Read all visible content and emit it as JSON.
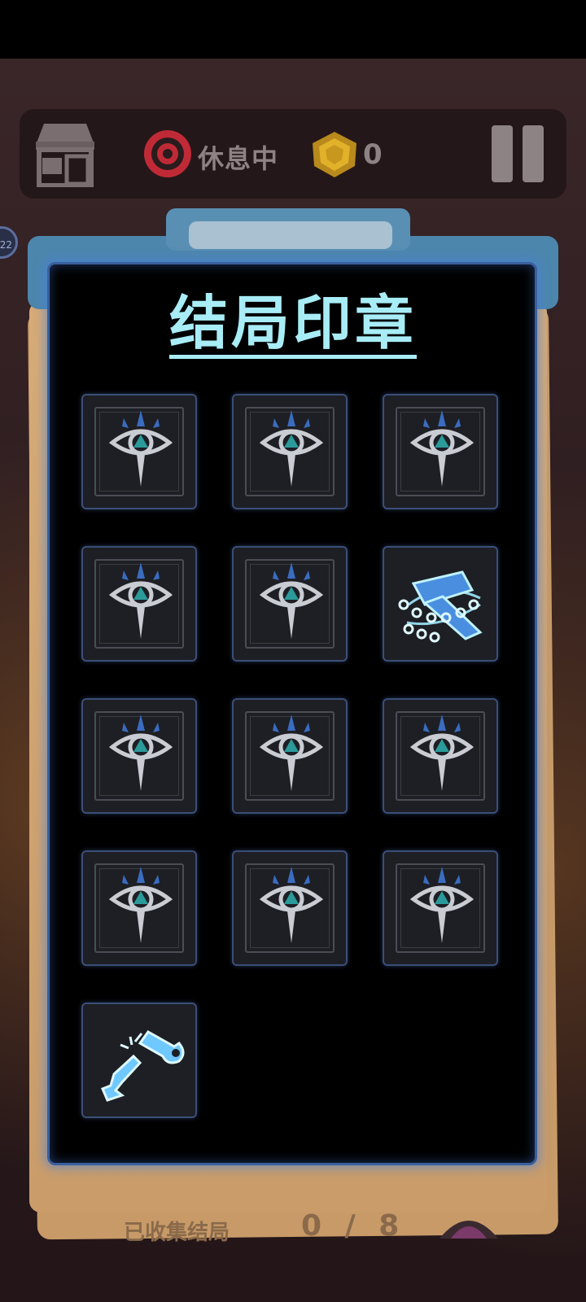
{
  "hud": {
    "status_text": "休息中",
    "coin_count": "0",
    "left_badge": "22"
  },
  "panel": {
    "title": "结局印章"
  },
  "footer": {
    "label": "已收集结局",
    "count": "0 / 8"
  },
  "stamps": [
    {
      "state": "locked",
      "icon": "eye-sigil-icon"
    },
    {
      "state": "locked",
      "icon": "eye-sigil-icon"
    },
    {
      "state": "locked",
      "icon": "eye-sigil-icon"
    },
    {
      "state": "locked",
      "icon": "eye-sigil-icon"
    },
    {
      "state": "locked",
      "icon": "eye-sigil-icon"
    },
    {
      "state": "unlocked",
      "icon": "chained-hammer-icon"
    },
    {
      "state": "locked",
      "icon": "eye-sigil-icon"
    },
    {
      "state": "locked",
      "icon": "eye-sigil-icon"
    },
    {
      "state": "locked",
      "icon": "eye-sigil-icon"
    },
    {
      "state": "locked",
      "icon": "eye-sigil-icon"
    },
    {
      "state": "locked",
      "icon": "eye-sigil-icon"
    },
    {
      "state": "locked",
      "icon": "eye-sigil-icon"
    },
    {
      "state": "unlocked",
      "icon": "broken-wrench-icon"
    }
  ],
  "colors": {
    "panel_border": "#3a5f9c",
    "title": "#a8ecf6",
    "unlocked_glow": "#8fe6ff"
  }
}
